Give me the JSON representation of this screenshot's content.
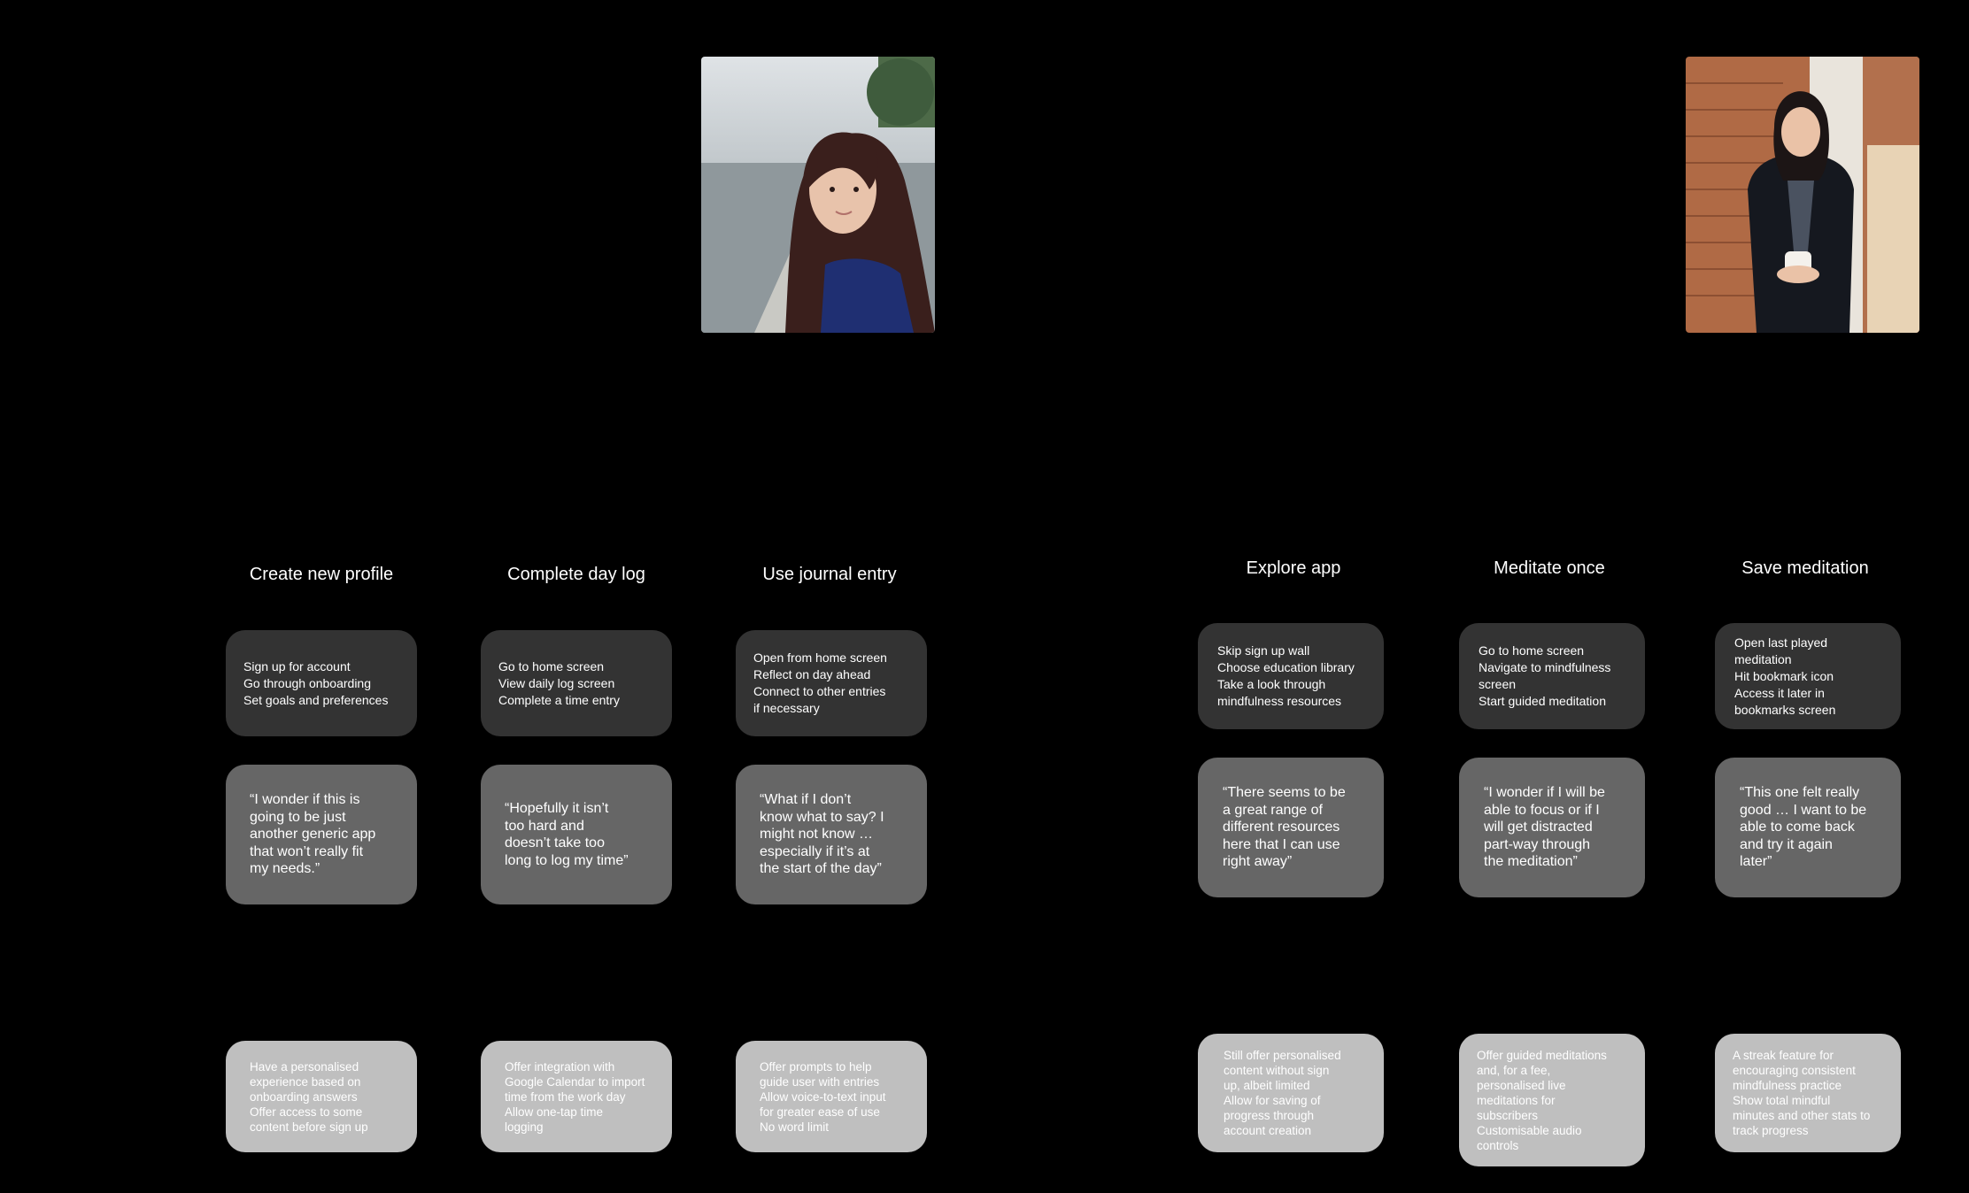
{
  "journeys": [
    {
      "photo": {
        "description_icon": "persona-photo-woman-waterfront"
      },
      "stages": [
        {
          "title": "Create new profile",
          "actions": "Sign up for account\nGo through onboarding\nSet goals and preferences",
          "quote": "“I wonder if this is\ngoing to be just\nanother generic app\nthat won’t really fit\nmy needs.”",
          "opportunities": "Have a personalised\nexperience based on\nonboarding answers\nOffer access to some\ncontent before sign up"
        },
        {
          "title": "Complete day log",
          "actions": "Go to home screen\nView daily log screen\nComplete a time entry",
          "quote": "“Hopefully it isn’t\ntoo hard and\ndoesn’t take too\nlong to log my time”",
          "opportunities": "Offer integration with\nGoogle Calendar to import\ntime from the work day\nAllow one-tap time\nlogging"
        },
        {
          "title": "Use journal entry",
          "actions": "Open from home screen\nReflect on day ahead\nConnect to other entries\nif necessary",
          "quote": "“What if I don’t\nknow what to say? I\nmight not know …\nespecially if it’s at\nthe start of the day”",
          "opportunities": "Offer prompts to help\nguide user with entries\nAllow voice-to-text input\nfor greater ease of use\nNo word limit"
        }
      ]
    },
    {
      "photo": {
        "description_icon": "persona-photo-woman-with-mug"
      },
      "stages": [
        {
          "title": "Explore app",
          "actions": "Skip sign up wall\nChoose education library\nTake a look through\nmindfulness resources",
          "quote": "“There seems to be\na great range of\ndifferent resources\nhere that I can use\nright away”",
          "opportunities": "Still offer personalised\ncontent without sign\nup, albeit limited\nAllow for saving of\nprogress through\naccount creation"
        },
        {
          "title": "Meditate once",
          "actions": "Go to home screen\nNavigate to mindfulness\nscreen\nStart guided meditation",
          "quote": "“I wonder if I will be\nable to focus or if I\nwill get distracted\npart-way through\nthe meditation”",
          "opportunities": "Offer guided meditations\nand, for a fee,\npersonalised live\nmeditations for\nsubscribers\nCustomisable audio\ncontrols"
        },
        {
          "title": "Save meditation",
          "actions": "Open last played\nmeditation\nHit bookmark icon\nAccess it later in\nbookmarks screen",
          "quote": "“This one felt really\ngood … I want to be\nable to come back\nand try it again\nlater”",
          "opportunities": "A streak feature for\nencouraging consistent\nmindfulness practice\nShow total mindful\nminutes and other stats to\ntrack progress"
        }
      ]
    }
  ],
  "colors": {
    "background": "#000000",
    "action_card": "#333333",
    "quote_card": "#666666",
    "opportunity_card": "#bfbfbf",
    "text": "#ffffff"
  }
}
